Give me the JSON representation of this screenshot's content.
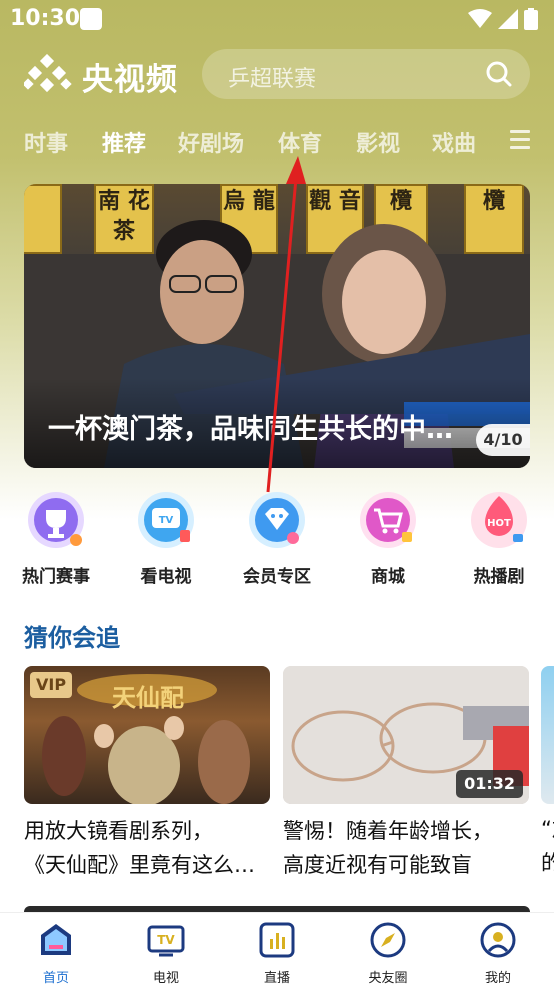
{
  "status_bar": {
    "time": "10:30"
  },
  "header": {
    "app_name": "央视频",
    "search_placeholder": "乒超联赛"
  },
  "tabs": [
    {
      "label": "时事",
      "active": false
    },
    {
      "label": "推荐",
      "active": true
    },
    {
      "label": "好剧场",
      "active": false
    },
    {
      "label": "体育",
      "active": false
    },
    {
      "label": "影视",
      "active": false
    },
    {
      "label": "戏曲",
      "active": false
    }
  ],
  "banner": {
    "title": "一杯澳门茶，品味同生共长的中…",
    "page_indicator": "4/10",
    "signs": [
      "南 花 茶",
      "烏 龍",
      "觀 音",
      "欖",
      "欖"
    ]
  },
  "quick_entries": [
    {
      "label": "热门赛事",
      "icon": "trophy-icon"
    },
    {
      "label": "看电视",
      "icon": "tv-icon"
    },
    {
      "label": "会员专区",
      "icon": "vip-diamond-icon"
    },
    {
      "label": "商城",
      "icon": "shopping-cart-icon"
    },
    {
      "label": "热播剧",
      "icon": "hot-icon"
    }
  ],
  "section": {
    "title": "猜你会追",
    "cards": [
      {
        "badge": "VIP",
        "thumb_text": "天仙配",
        "line1": "用放大镜看剧系列，",
        "line2": "《天仙配》里竟有这么…"
      },
      {
        "duration": "01:32",
        "line1": "警惕！随着年龄增长，",
        "line2": "高度近视有可能致盲"
      }
    ],
    "peek_line1": "“加",
    "peek_line2": "的"
  },
  "bottom_nav": [
    {
      "label": "首页",
      "active": true,
      "icon": "home-icon"
    },
    {
      "label": "电视",
      "active": false,
      "icon": "tv-icon"
    },
    {
      "label": "直播",
      "active": false,
      "icon": "live-icon"
    },
    {
      "label": "央友圈",
      "active": false,
      "icon": "compass-icon"
    },
    {
      "label": "我的",
      "active": false,
      "icon": "profile-icon"
    }
  ],
  "colors": {
    "header_bg": "#b9b862",
    "section_title": "#1c5ea0",
    "nav_active": "#1c6fd0",
    "annotation_arrow": "#e02020"
  }
}
